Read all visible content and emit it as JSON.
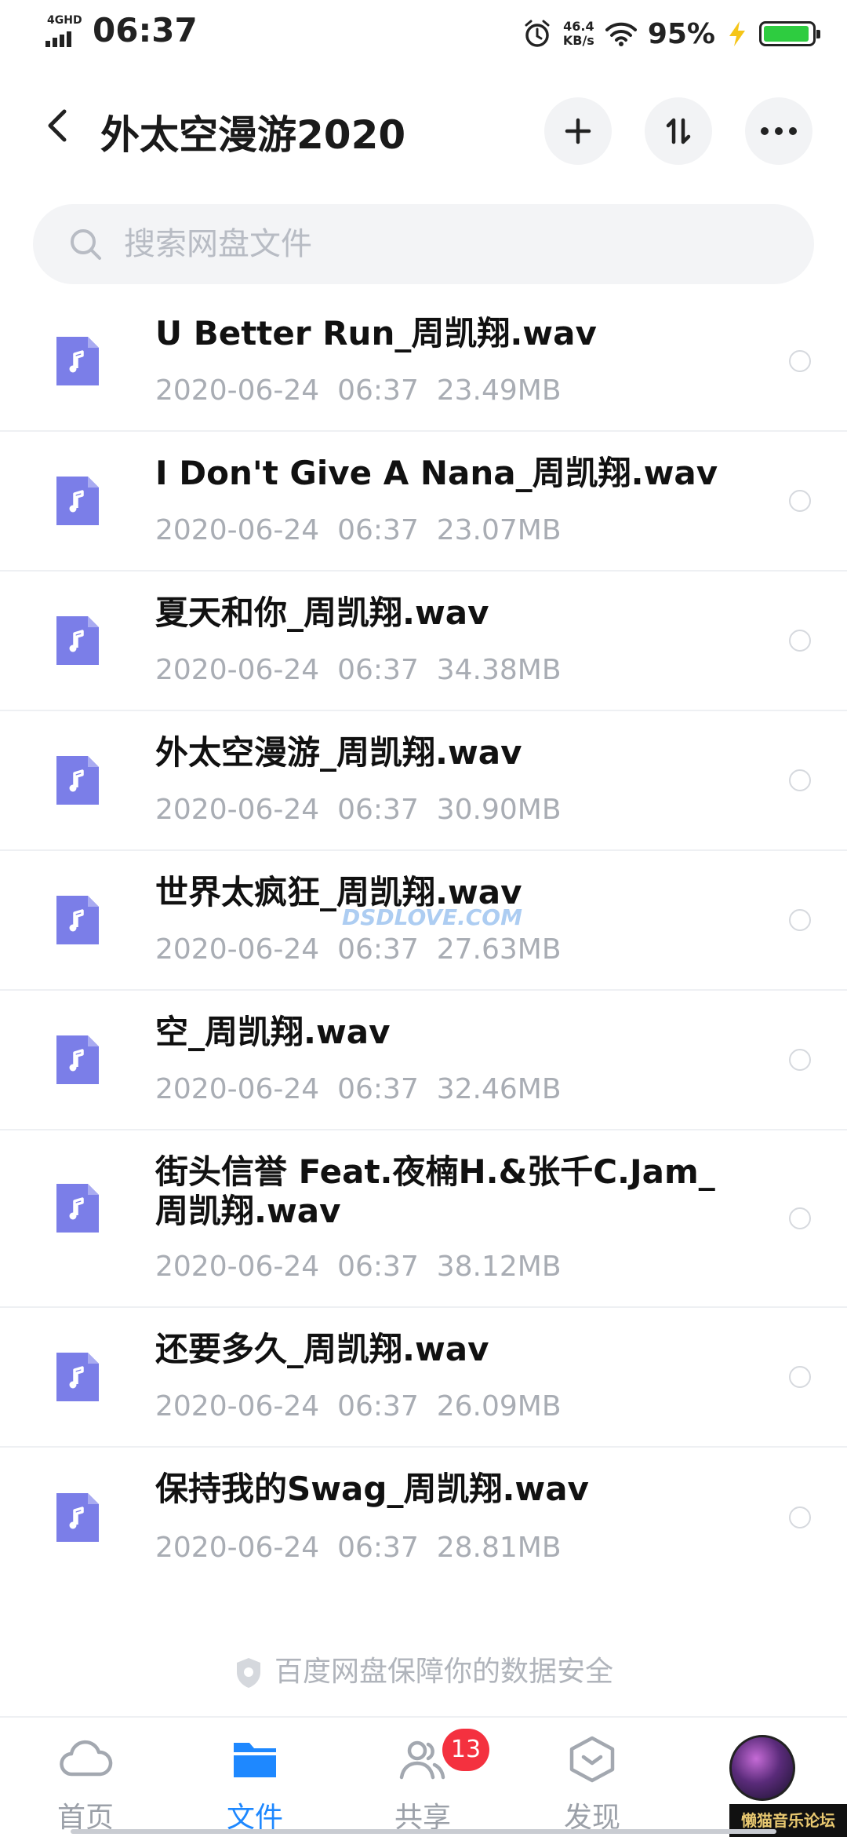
{
  "status_bar": {
    "network": "4GHD",
    "time": "06:37",
    "speed_value": "46.4",
    "speed_unit": "KB/s",
    "battery_percent": "95%",
    "battery_level": 0.95
  },
  "header": {
    "title": "外太空漫游2020",
    "icons": [
      "back-arrow-icon",
      "plus-icon",
      "sort-icon",
      "more-icon"
    ]
  },
  "search": {
    "placeholder": "搜索网盘文件"
  },
  "files": [
    {
      "name": "U Better Run_周凯翔.wav",
      "date": "2020-06-24",
      "time": "06:37",
      "size": "23.49MB"
    },
    {
      "name": "I Don't Give A Nana_周凯翔.wav",
      "date": "2020-06-24",
      "time": "06:37",
      "size": "23.07MB"
    },
    {
      "name": "夏天和你_周凯翔.wav",
      "date": "2020-06-24",
      "time": "06:37",
      "size": "34.38MB"
    },
    {
      "name": "外太空漫游_周凯翔.wav",
      "date": "2020-06-24",
      "time": "06:37",
      "size": "30.90MB"
    },
    {
      "name": "世界太疯狂_周凯翔.wav",
      "date": "2020-06-24",
      "time": "06:37",
      "size": "27.63MB"
    },
    {
      "name": "空_周凯翔.wav",
      "date": "2020-06-24",
      "time": "06:37",
      "size": "32.46MB"
    },
    {
      "name": "街头信誉 Feat.夜楠H.&张千C.Jam_周凯翔.wav",
      "date": "2020-06-24",
      "time": "06:37",
      "size": "38.12MB"
    },
    {
      "name": "还要多久_周凯翔.wav",
      "date": "2020-06-24",
      "time": "06:37",
      "size": "26.09MB"
    },
    {
      "name": "保持我的Swag_周凯翔.wav",
      "date": "2020-06-24",
      "time": "06:37",
      "size": "28.81MB"
    }
  ],
  "watermark": "DSDLOVE.COM",
  "footer_note": "百度网盘保障你的数据安全",
  "tabs": [
    {
      "label": "首页",
      "icon": "cloud-icon",
      "active": false
    },
    {
      "label": "文件",
      "icon": "folder-icon",
      "active": true
    },
    {
      "label": "共享",
      "icon": "share-people-icon",
      "active": false,
      "badge": "13"
    },
    {
      "label": "发现",
      "icon": "discover-icon",
      "active": false
    }
  ],
  "forum_label": "懒猫音乐论坛",
  "colors": {
    "accent": "#1e88ff",
    "file_icon": "#7b7ee8",
    "badge": "#f4313f",
    "battery": "#2ecc40"
  }
}
